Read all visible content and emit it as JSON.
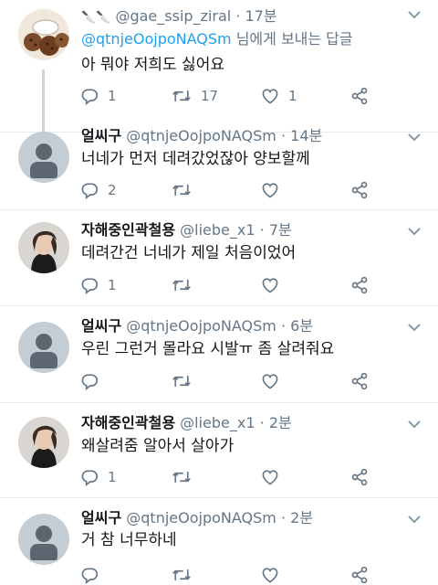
{
  "tweets": [
    {
      "name": "",
      "name_emoji": "🔪🔪",
      "handle": "@gae_ssip_ziral",
      "time": "17분",
      "reply_at": "@qtnjeOojpoNAQSm",
      "reply_suffix": " 님에게 보내는 답글",
      "text": "아 뭐야 저희도 싫어요",
      "reply_count": "1",
      "retweet_count": "17",
      "like_count": "1"
    },
    {
      "name": "얼씨구",
      "handle": "@qtnjeOojpoNAQSm",
      "time": "14분",
      "text": "너네가 먼저 데려갔었잖아 양보할께",
      "reply_count": "2",
      "retweet_count": "",
      "like_count": ""
    },
    {
      "name": "자해중인곽철용",
      "handle": "@liebe_x1",
      "time": "7분",
      "text": "데려간건 너네가 제일 처음이었어",
      "reply_count": "1",
      "retweet_count": "",
      "like_count": ""
    },
    {
      "name": "얼씨구",
      "handle": "@qtnjeOojpoNAQSm",
      "time": "6분",
      "text": "우린 그런거 몰라요 시발ㅠ 좀 살려줘요",
      "reply_count": "",
      "retweet_count": "",
      "like_count": ""
    },
    {
      "name": "자해중인곽철용",
      "handle": "@liebe_x1",
      "time": "2분",
      "text": "왜살려줌 알아서 살아가",
      "reply_count": "1",
      "retweet_count": "",
      "like_count": ""
    },
    {
      "name": "얼씨구",
      "handle": "@qtnjeOojpoNAQSm",
      "time": "2분",
      "text": "거 참 너무하네",
      "reply_count": "",
      "retweet_count": "",
      "like_count": ""
    }
  ],
  "separator": "·",
  "icons": {
    "reply": "reply-icon",
    "retweet": "retweet-icon",
    "like": "heart-icon",
    "share": "share-icon",
    "caret": "chevron-down-icon"
  },
  "colors": {
    "link": "#1da1f2",
    "muted": "#657786",
    "divider": "#e6ecf0"
  }
}
